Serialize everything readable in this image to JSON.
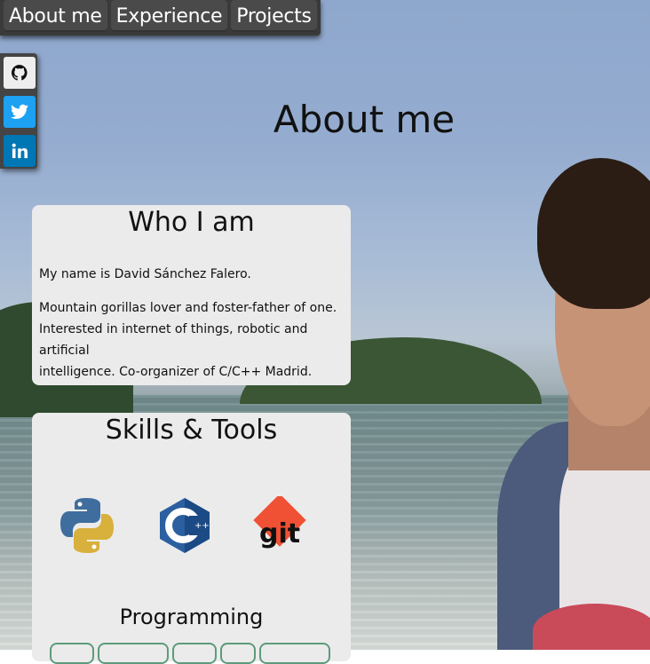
{
  "nav": {
    "items": [
      {
        "label": "About me"
      },
      {
        "label": "Experience"
      },
      {
        "label": "Projects"
      }
    ]
  },
  "social": {
    "icons": [
      "github-icon",
      "twitter-icon",
      "linkedin-icon"
    ],
    "colors": {
      "github": "#eeeeee",
      "twitter": "#1da1f2",
      "linkedin": "#0077b5"
    }
  },
  "page": {
    "title": "About me"
  },
  "who": {
    "heading": "Who I am",
    "paragraph1": "My name is David Sánchez Falero.",
    "paragraph2_line1": "Mountain gorillas lover and foster-father of one.",
    "paragraph2_line2": "Interested in internet of things, robotic and artificial",
    "paragraph2_line3": "intelligence. Co-organizer of C/C++ Madrid."
  },
  "skills": {
    "heading": "Skills & Tools",
    "logos": [
      "python-logo",
      "cpp-logo",
      "git-logo"
    ],
    "git_text": "git",
    "cpp_text": "C",
    "subheading": "Programming"
  }
}
